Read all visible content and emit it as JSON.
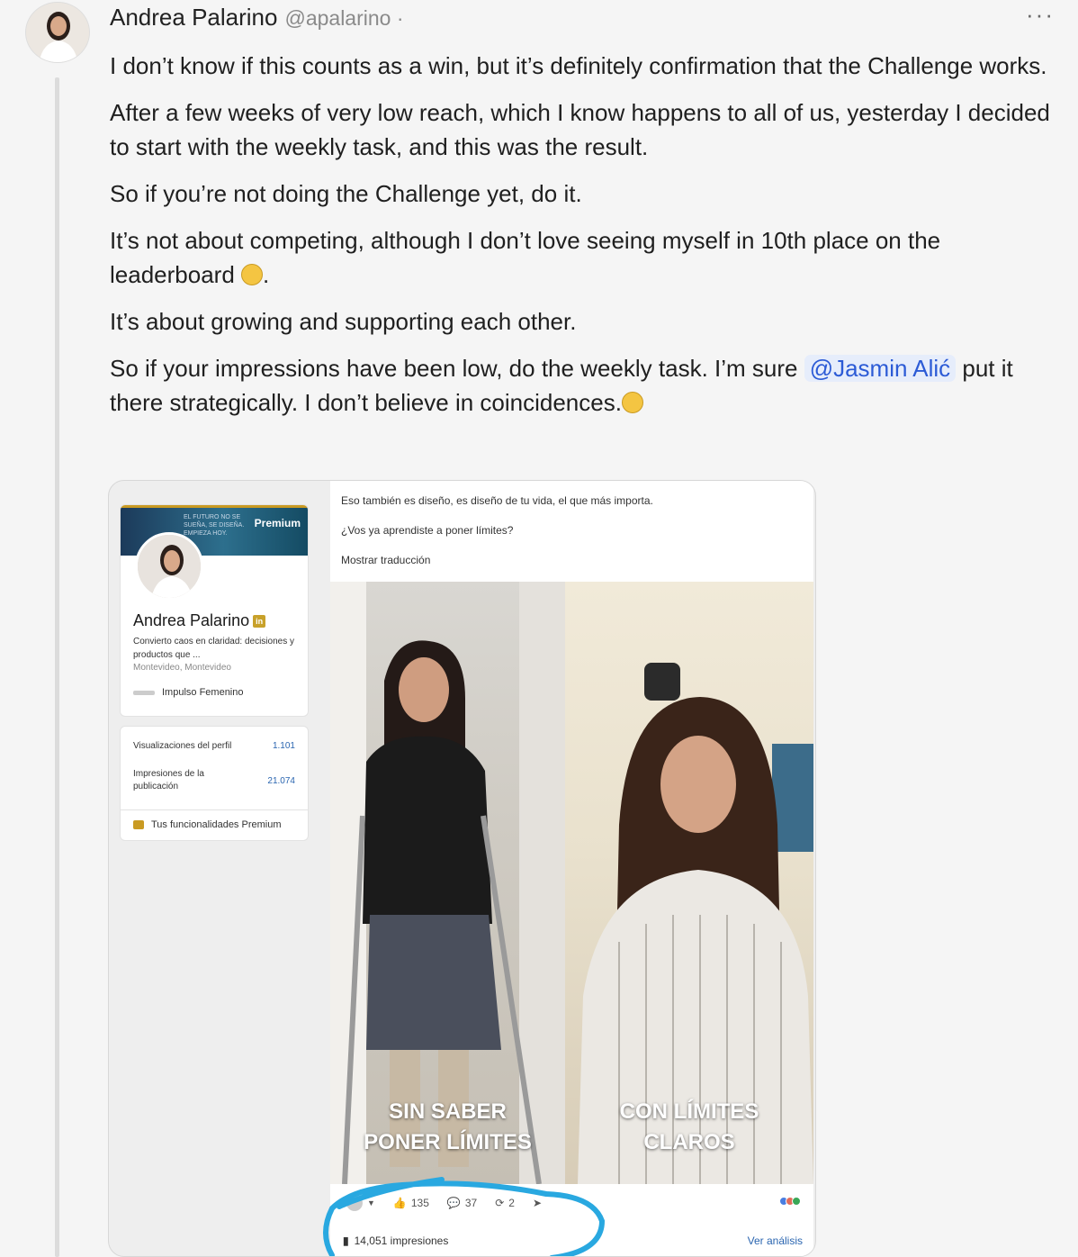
{
  "post": {
    "author_name": "Andrea Palarino",
    "handle": "@apalarino ·",
    "more_label": "···",
    "paragraphs": [
      "I don’t know if this counts as a win, but it’s definitely confirmation that the Challenge works.",
      "After a few weeks of very low reach, which I know happens to all of us, yesterday I decided to start with the weekly task, and this was the result.",
      "So if you’re not doing the Challenge yet, do it.",
      "It’s not about competing, although I don’t love seeing myself in 10th place on the leaderboard",
      "It’s about growing and supporting each other."
    ],
    "para4_end": ".",
    "last_para_before": "So if your impressions have been low, do the weekly task. I’m sure ",
    "mention": "@Jasmin Alić",
    "last_para_after": " put it there strategically. I don’t believe in coincidences.",
    "emoji_grin": "grinning-face-emoji",
    "emoji_sunglasses": "sunglasses-emoji"
  },
  "attachment": {
    "profile_card": {
      "premium_label": "Premium",
      "banner_text": "EL FUTURO NO SE SUEÑA, SE DISEÑA. EMPIEZA HOY.",
      "name": "Andrea Palarino",
      "badge": "in",
      "description": "Convierto caos en claridad: decisiones y productos que ...",
      "location": "Montevideo, Montevideo",
      "organization": "Impulso Femenino"
    },
    "stats": {
      "profile_views_label": "Visualizaciones del perfil",
      "profile_views_value": "1.101",
      "post_impressions_label": "Impresiones de la publicación",
      "post_impressions_value": "21.074",
      "premium_features_label": "Tus funcionalidades Premium"
    },
    "li_post": {
      "line1": "Eso también es diseño, es diseño de tu vida, el que más importa.",
      "line2": "¿Vos ya aprendiste a poner límites?",
      "translate_label": "Mostrar traducción",
      "caption_left_1": "SIN SABER",
      "caption_left_2": "PONER LÍMITES",
      "caption_right_1": "CON LÍMITES",
      "caption_right_2": "CLAROS",
      "likes": "135",
      "comments": "37",
      "reposts": "2",
      "impressions": "14,051 impresiones",
      "analytics_label": "Ver análisis"
    }
  },
  "colors": {
    "mention_bg": "#e6edfb",
    "mention_text": "#2c5bd6",
    "highlight_stroke": "#29a8e0",
    "linkedin_blue": "#2a65b0"
  }
}
